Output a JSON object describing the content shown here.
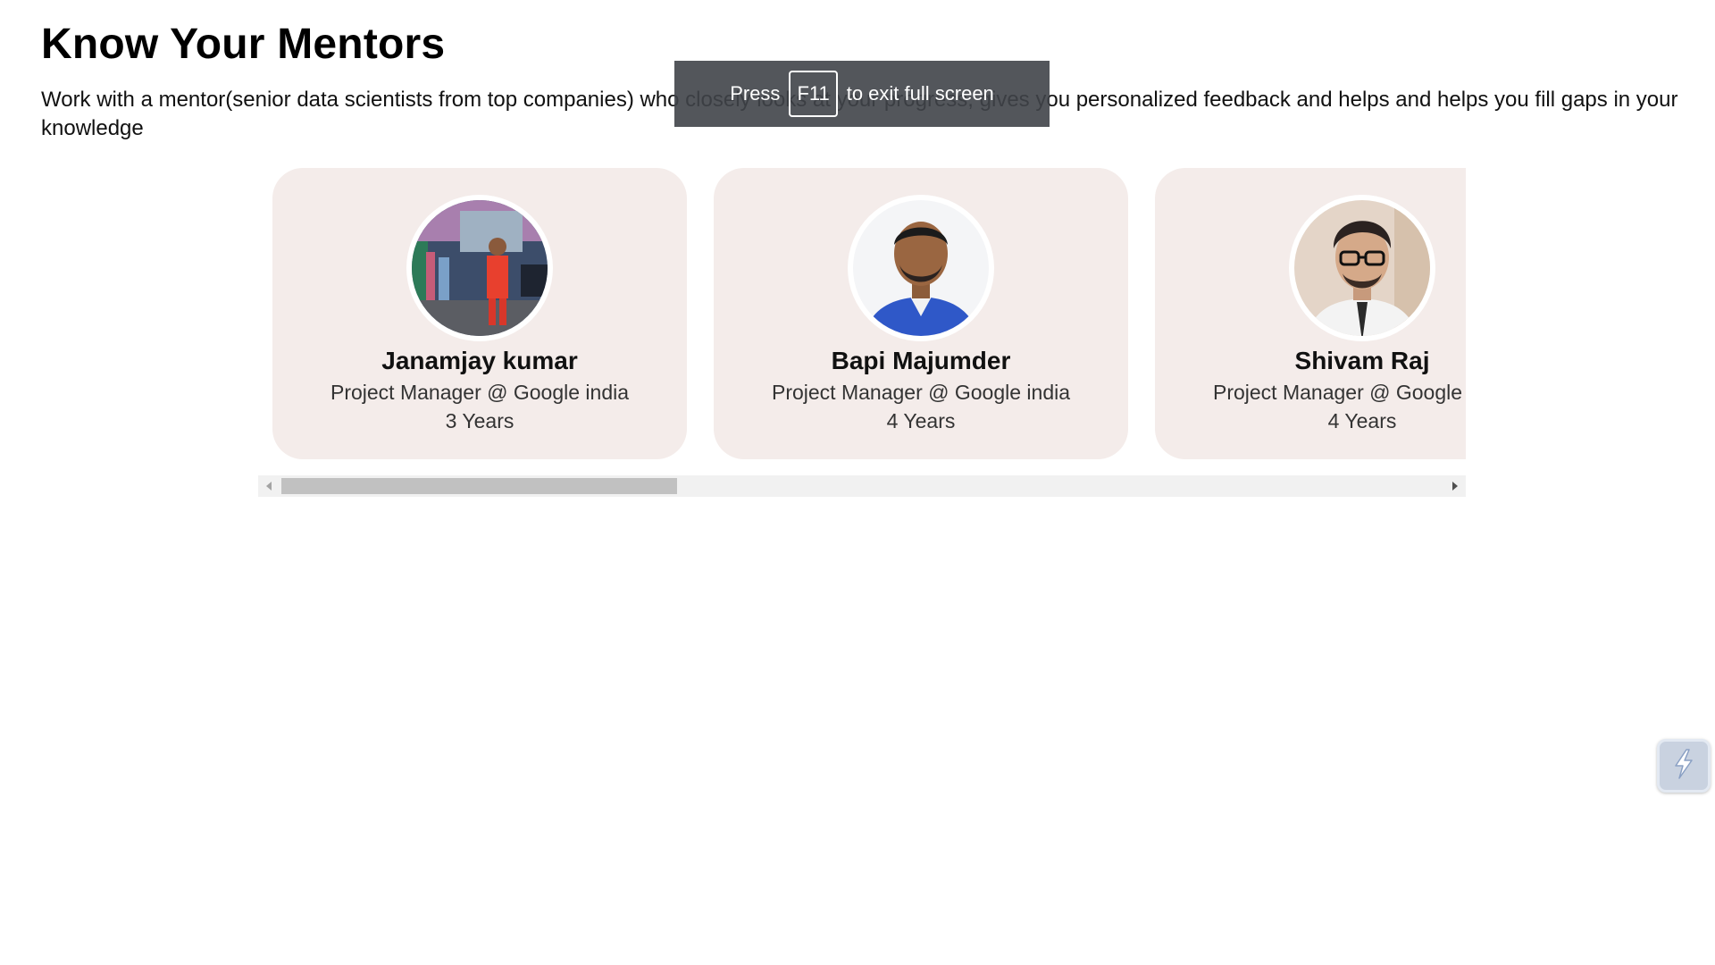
{
  "page": {
    "title": "Know Your Mentors",
    "description": "Work with a mentor(senior data scientists from top companies) who closely looks at your progress, gives you personalized feedback and helps and helps you fill gaps in your knowledge"
  },
  "mentors": [
    {
      "name": "Janamjay kumar",
      "role": "Project Manager @ Google india",
      "experience": "3 Years"
    },
    {
      "name": "Bapi Majumder",
      "role": "Project Manager @ Google india",
      "experience": "4 Years"
    },
    {
      "name": "Shivam Raj",
      "role": "Project Manager @ Google india",
      "experience": "4 Years"
    }
  ],
  "fullscreen_toast": {
    "before": "Press",
    "key": "F11",
    "after": "to exit full screen"
  },
  "icons": {
    "scroll_left": "triangle-left-icon",
    "scroll_right": "triangle-right-icon",
    "widget": "lightning-bolt-icon"
  },
  "colors": {
    "card_background": "#f4ecea",
    "scrollbar_track": "#f1f1f1",
    "scrollbar_thumb": "#c1c1c1",
    "toast_background": "#404449"
  }
}
